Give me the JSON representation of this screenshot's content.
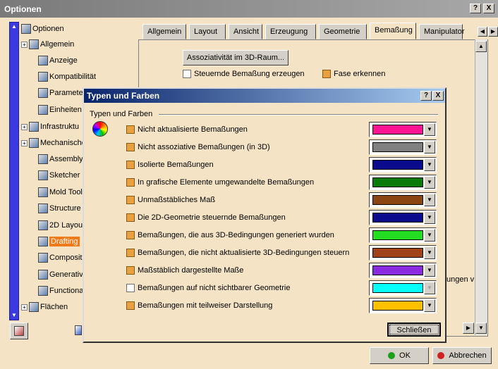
{
  "window": {
    "title": "Optionen",
    "help_btn": "?",
    "close_btn": "X"
  },
  "tree": {
    "items": [
      {
        "label": "Optionen",
        "icon": "options-tree-icon"
      },
      {
        "label": "Allgemein",
        "icon": "general-icon"
      },
      {
        "label": "Anzeige",
        "icon": "display-icon"
      },
      {
        "label": "Kompatibilität",
        "icon": "compatibility-icon"
      },
      {
        "label": "Paramete",
        "icon": "parameters-icon"
      },
      {
        "label": "Einheiten",
        "icon": "units-icon"
      },
      {
        "label": "Infrastruktu",
        "icon": "infrastructure-icon"
      },
      {
        "label": "Mechanische",
        "icon": "mechanical-icon"
      },
      {
        "label": "Assembly",
        "icon": "assembly-icon"
      },
      {
        "label": "Sketcher",
        "icon": "sketcher-icon"
      },
      {
        "label": "Mold Tool",
        "icon": "mold-tool-icon"
      },
      {
        "label": "Structure",
        "icon": "structure-icon"
      },
      {
        "label": "2D Layou",
        "icon": "layout-2d-icon"
      },
      {
        "label": "Drafting",
        "icon": "drafting-icon"
      },
      {
        "label": "Composit",
        "icon": "composites-icon"
      },
      {
        "label": "Generativ",
        "icon": "generative-icon"
      },
      {
        "label": "Functiona",
        "icon": "functional-icon"
      },
      {
        "label": "Flächen",
        "icon": "surfaces-icon"
      }
    ]
  },
  "tabs": [
    "Allgemein",
    "Layout",
    "Ansicht",
    "Erzeugung",
    "Geometrie",
    "Bemaßung",
    "Manipulator"
  ],
  "active_tab": "Bemaßung",
  "panel": {
    "assoc_button": "Assoziativität im 3D-Raum...",
    "check_steuernde": "Steuernde Bemaßung erzeugen",
    "check_fase": "Fase erkennen",
    "partial_text": "ungen v"
  },
  "dialog": {
    "title": "Typen und Farben",
    "help_btn": "?",
    "close_btn": "X",
    "group_label": "Typen und Farben",
    "rows": [
      {
        "label": "Nicht aktualisierte Bemaßungen",
        "checked": true,
        "color": "#ff1493",
        "enabled": true
      },
      {
        "label": "Nicht assoziative Bemaßungen (in 3D)",
        "checked": true,
        "color": "#808080",
        "enabled": true
      },
      {
        "label": "Isolierte Bemaßungen",
        "checked": true,
        "color": "#0a0a8c",
        "enabled": true
      },
      {
        "label": "In grafische Elemente umgewandelte Bemaßungen",
        "checked": true,
        "color": "#0a7a0a",
        "enabled": true
      },
      {
        "label": "Unmaßstäbliches Maß",
        "checked": true,
        "color": "#8b4513",
        "enabled": true
      },
      {
        "label": "Die 2D-Geometrie steuernde Bemaßungen",
        "checked": true,
        "color": "#0a0a8c",
        "enabled": true
      },
      {
        "label": "Bemaßungen, die aus 3D-Bedingungen generiert wurden",
        "checked": true,
        "color": "#22dd22",
        "enabled": true
      },
      {
        "label": "Bemaßungen, die nicht aktualisierte 3D-Bedingungen steuern",
        "checked": true,
        "color": "#a0421a",
        "enabled": true
      },
      {
        "label": "Maßstäblich dargestellte Maße",
        "checked": true,
        "color": "#8a2be2",
        "enabled": true
      },
      {
        "label": "Bemaßungen auf nicht sichtbarer Geometrie",
        "checked": false,
        "color": "#00ffff",
        "enabled": false
      },
      {
        "label": "Bemaßungen mit teilweiser Darstellung",
        "checked": true,
        "color": "#ffc000",
        "enabled": true
      }
    ],
    "close_button": "Schließen"
  },
  "footer": {
    "ok": "OK",
    "cancel": "Abbrechen"
  }
}
